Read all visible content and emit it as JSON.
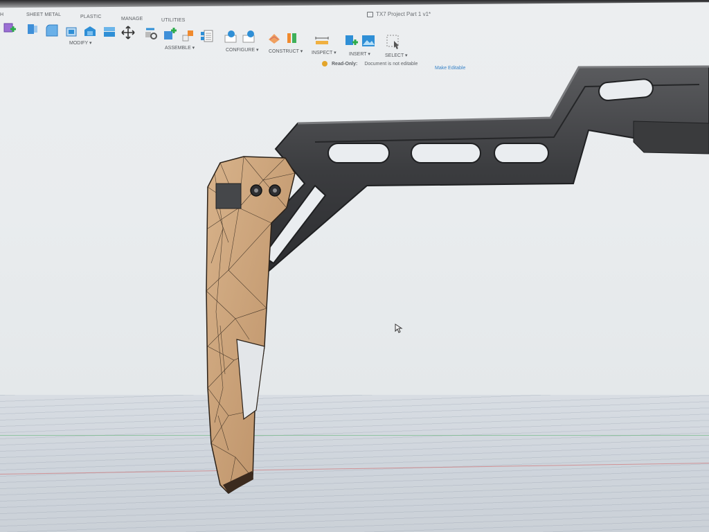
{
  "window": {
    "title": "TX7 Project Part 1 v1*"
  },
  "toolbar": {
    "tabs": {
      "partial": "H",
      "sheet_metal": "SHEET METAL",
      "plastic": "PLASTIC",
      "manage": "MANAGE",
      "utilities": "UTILITIES"
    },
    "groups": {
      "modify": "MODIFY ▾",
      "assemble": "ASSEMBLE ▾",
      "configure": "CONFIGURE ▾",
      "construct": "CONSTRUCT ▾",
      "inspect": "INSPECT ▾",
      "insert": "INSERT ▾",
      "select": "SELECT ▾"
    }
  },
  "status": {
    "readonly_label": "Read-Only:",
    "readonly_message": "Document is not editable",
    "make_editable": "Make Editable"
  },
  "icons": [
    "create-form-icon",
    "split-body-icon",
    "fillet-icon",
    "press-pull-icon",
    "shell-icon",
    "combine-icon",
    "move-icon",
    "joint-icon",
    "new-component-icon",
    "rigid-group-icon",
    "bill-of-materials-icon",
    "configure-table-icon",
    "configure-rule-icon",
    "construct-plane-icon",
    "construct-midplane-icon",
    "measure-icon",
    "insert-mesh-icon",
    "insert-canvas-icon",
    "select-icon",
    "lock-icon",
    "warning-icon",
    "cursor-icon"
  ],
  "colors": {
    "mesh_body": "#c9a27a",
    "mesh_lines": "#2b2118",
    "dark_body": "#3a3b3d",
    "accent_blue": "#2f8fd6",
    "warning": "#e3a52a",
    "link": "#3a84c8"
  }
}
